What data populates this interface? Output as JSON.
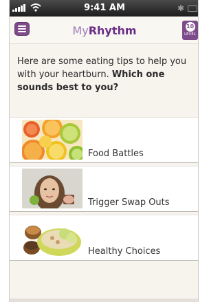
{
  "status_bar": {
    "time": "9:41 AM"
  },
  "header": {
    "logo_prefix": "My",
    "logo_main": "Rhythm",
    "level_number": "10",
    "level_label": "LEVEL"
  },
  "intro": {
    "text": "Here are some eating tips to help you with your heartburn. ",
    "question": "Which one sounds best to you?"
  },
  "options": [
    {
      "label": "Food Battles",
      "image": "citrus-fruits-image"
    },
    {
      "label": "Trigger Swap Outs",
      "image": "woman-choosing-food-image"
    },
    {
      "label": "Healthy Choices",
      "image": "healthy-bowls-image"
    }
  ],
  "colors": {
    "brand_purple": "#7d4a8a",
    "logo_dark": "#6a2e87",
    "background": "#f7f4ee"
  }
}
